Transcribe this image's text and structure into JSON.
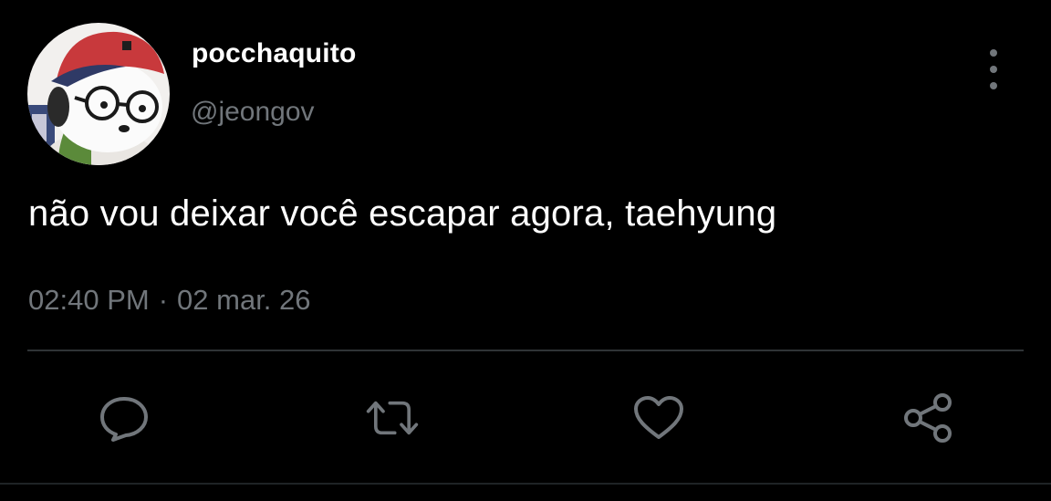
{
  "tweet": {
    "display_name": "pocchaquito",
    "handle": "@jeongov",
    "text": "não vou deixar você escapar agora, taehyung",
    "time": "02:40 PM",
    "separator": "·",
    "date": "02 mar. 26"
  },
  "icons": {
    "avatar": "profile-avatar",
    "more": "more-vertical-icon",
    "reply": "reply-icon",
    "retweet": "retweet-icon",
    "like": "heart-icon",
    "share": "share-icon"
  },
  "colors": {
    "background": "#000000",
    "text_primary": "#ffffff",
    "text_secondary": "#71767b",
    "divider": "#2f3336"
  }
}
